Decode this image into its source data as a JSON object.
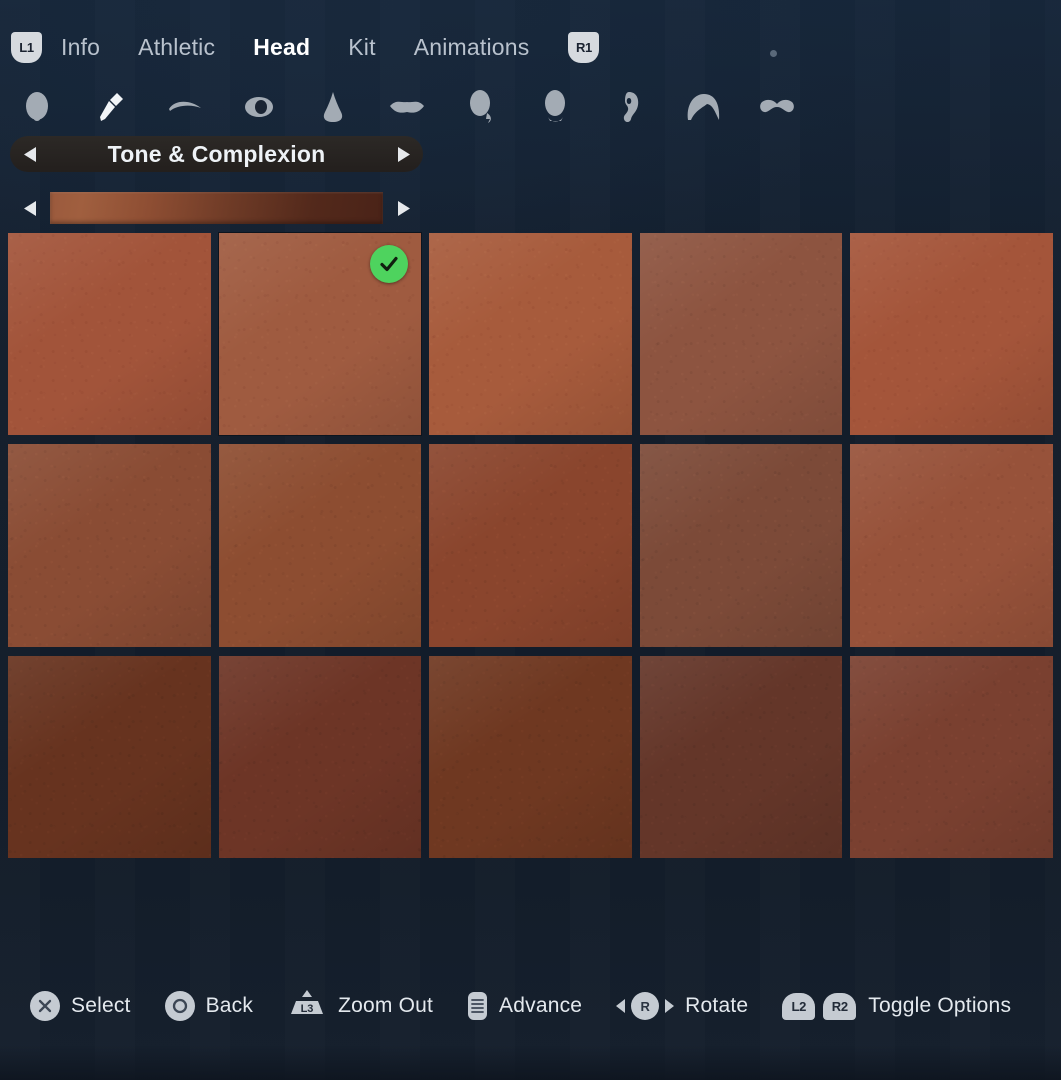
{
  "window": {
    "title": "Character Creator - Head - Tone & Complexion",
    "background_color": "#131d2b"
  },
  "top_nav": {
    "left_bumper": "L1",
    "right_bumper": "R1",
    "tabs": [
      {
        "label": "Info",
        "active": false
      },
      {
        "label": "Athletic",
        "active": false
      },
      {
        "label": "Head",
        "active": true
      },
      {
        "label": "Kit",
        "active": false
      },
      {
        "label": "Animations",
        "active": false
      }
    ]
  },
  "feature_icons": [
    {
      "name": "face-shape-icon",
      "label": "Face Shape",
      "active": false
    },
    {
      "name": "skin-tone-brush-icon",
      "label": "Skin Tone",
      "active": true
    },
    {
      "name": "eyebrow-icon",
      "label": "Eyebrows",
      "active": false
    },
    {
      "name": "eye-icon",
      "label": "Eyes",
      "active": false
    },
    {
      "name": "nose-icon",
      "label": "Nose",
      "active": false
    },
    {
      "name": "lips-icon",
      "label": "Lips",
      "active": false
    },
    {
      "name": "cheek-icon",
      "label": "Cheeks",
      "active": false
    },
    {
      "name": "chin-icon",
      "label": "Chin",
      "active": false
    },
    {
      "name": "ear-icon",
      "label": "Ears",
      "active": false
    },
    {
      "name": "hair-icon",
      "label": "Hair",
      "active": false
    },
    {
      "name": "facial-hair-icon",
      "label": "Facial Hair",
      "active": false
    }
  ],
  "category_selector": {
    "label": "Tone & Complexion",
    "prev_arrow": "◀",
    "next_arrow": "▶"
  },
  "tone_strip": {
    "prev_arrow": "◀",
    "next_arrow": "▶",
    "gradient_start": "#9b5a3d",
    "gradient_end": "#4a2318"
  },
  "swatch_grid": {
    "columns": 5,
    "rows": 3,
    "selected_index": 1,
    "selected_badge": "check-icon",
    "selected_badge_color": "#4ed35e",
    "selection_border_color": "#ced3d9",
    "swatches": [
      {
        "index": 0,
        "color": "#a2543a",
        "name": "tone-1"
      },
      {
        "index": 1,
        "color": "#9f5b40",
        "name": "tone-2"
      },
      {
        "index": 2,
        "color": "#a75b3c",
        "name": "tone-3"
      },
      {
        "index": 3,
        "color": "#8d5440",
        "name": "tone-4"
      },
      {
        "index": 4,
        "color": "#a4553a",
        "name": "tone-5"
      },
      {
        "index": 5,
        "color": "#8a4c34",
        "name": "tone-6"
      },
      {
        "index": 6,
        "color": "#8d4d31",
        "name": "tone-7"
      },
      {
        "index": 7,
        "color": "#8a452d",
        "name": "tone-8"
      },
      {
        "index": 8,
        "color": "#7c4a38",
        "name": "tone-9"
      },
      {
        "index": 9,
        "color": "#97523a",
        "name": "tone-10"
      },
      {
        "index": 10,
        "color": "#67331f",
        "name": "tone-11"
      },
      {
        "index": 11,
        "color": "#6d3526",
        "name": "tone-12"
      },
      {
        "index": 12,
        "color": "#6f3821",
        "name": "tone-13"
      },
      {
        "index": 13,
        "color": "#643629",
        "name": "tone-14"
      },
      {
        "index": 14,
        "color": "#7a4030",
        "name": "tone-15"
      }
    ]
  },
  "action_bar": {
    "actions": [
      {
        "name": "select",
        "glyph": "cross-button-icon",
        "label": "Select"
      },
      {
        "name": "back",
        "glyph": "circle-button-icon",
        "label": "Back"
      },
      {
        "name": "zoom-out",
        "glyph": "l3-stick-icon",
        "label": "Zoom Out",
        "button": "L3"
      },
      {
        "name": "advance",
        "glyph": "touchpad-icon",
        "label": "Advance"
      },
      {
        "name": "rotate",
        "glyph": "right-stick-icon",
        "label": "Rotate",
        "button": "R"
      },
      {
        "name": "toggle-options",
        "glyph": "l2-r2-icon",
        "label": "Toggle Options",
        "buttons": [
          "L2",
          "R2"
        ]
      }
    ]
  }
}
